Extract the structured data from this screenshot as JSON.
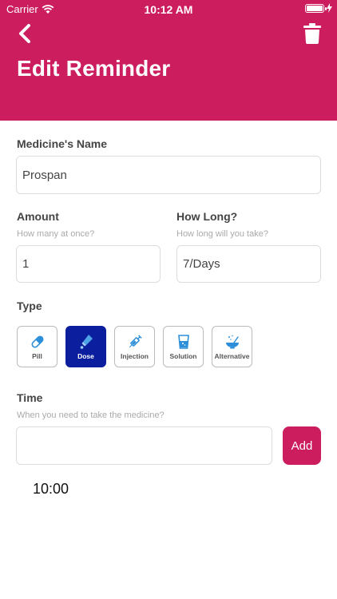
{
  "status_bar": {
    "carrier": "Carrier",
    "time": "10:12 AM",
    "battery_level": 1.0
  },
  "header": {
    "title": "Edit Reminder",
    "back_icon": "chevron-left-icon",
    "delete_icon": "trash-icon"
  },
  "colors": {
    "accent": "#cc1d5f",
    "selected_type": "#0b1f9e",
    "icon_blue": "#2d8fd9"
  },
  "medicine": {
    "label": "Medicine's Name",
    "value": "Prospan"
  },
  "amount": {
    "label": "Amount",
    "hint": "How many at once?",
    "value": "1"
  },
  "how_long": {
    "label": "How Long?",
    "hint": "How long will you take?",
    "value": "7/Days"
  },
  "type": {
    "label": "Type",
    "selected": "Dose",
    "options": [
      {
        "label": "Pill",
        "icon": "pill-icon"
      },
      {
        "label": "Dose",
        "icon": "dropper-icon"
      },
      {
        "label": "Injection",
        "icon": "syringe-icon"
      },
      {
        "label": "Solution",
        "icon": "glass-icon"
      },
      {
        "label": "Alternative",
        "icon": "bowl-icon"
      }
    ]
  },
  "time": {
    "label": "Time",
    "hint": "When you need to take the medicine?",
    "value": "",
    "add_label": "Add",
    "entries": [
      "10:00"
    ]
  }
}
